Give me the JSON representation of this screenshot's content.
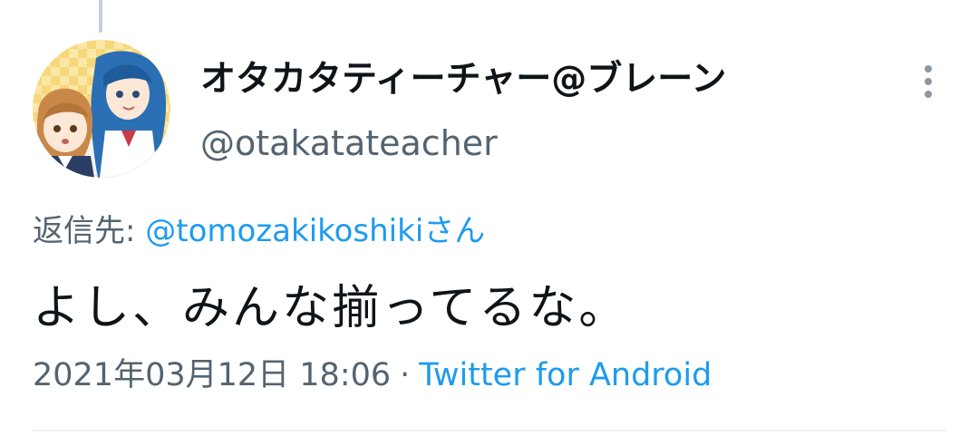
{
  "tweet": {
    "author": {
      "display_name": "オタカタティーチャー@ブレーン",
      "handle": "@otakatateacher"
    },
    "reply_to": {
      "prefix": "返信先: ",
      "mention": "@tomozakikoshikiさん"
    },
    "text": "よし、みんな揃ってるな。",
    "timestamp": "2021年03月12日 18:06",
    "separator": "·",
    "source": "Twitter for Android"
  },
  "icons": {
    "more": "vertical-ellipsis-icon"
  },
  "colors": {
    "text_primary": "#0f1419",
    "text_secondary": "#536471",
    "link": "#1d9bf0",
    "thread_line": "#c4cfd6",
    "divider": "#eff3f4"
  }
}
